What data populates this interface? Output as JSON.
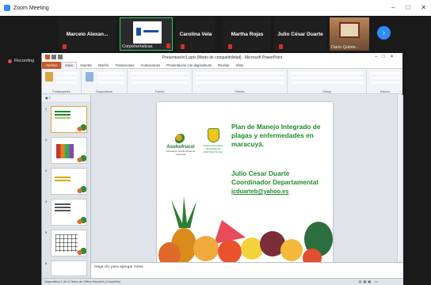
{
  "window": {
    "title": "Zoom Meeting",
    "controls": [
      "–",
      "□",
      "✕"
    ]
  },
  "participants": [
    {
      "name": "Marcelo Alexan..."
    },
    {
      "name": "",
      "caption": "Corpohortalizas",
      "active": true
    },
    {
      "name": "Carolina Vela"
    },
    {
      "name": "Martha Rojas"
    },
    {
      "name": "Julio César Duarte"
    },
    {
      "name": "",
      "caption": "Dario Quinte..."
    }
  ],
  "next_label": "›",
  "recording": {
    "label": "Recording"
  },
  "powerpoint": {
    "title": "Presentación1.pptx [Modo de compatibilidad] - Microsoft PowerPoint",
    "tabs": [
      "Archivo",
      "Inicio",
      "Insertar",
      "Diseño",
      "Transiciones",
      "Animaciones",
      "Presentación con diapositivas",
      "Revisar",
      "Vista"
    ],
    "groups": [
      "Portapapeles",
      "Diapositivas",
      "Fuente",
      "Párrafo",
      "Dibujo",
      "Edición"
    ],
    "slide_numbers": [
      "1",
      "2",
      "3",
      "4",
      "5",
      "6"
    ],
    "notes_placeholder": "Haga clic para agregar notas",
    "status": "Diapositiva 1 de 6   Tema de Office   Español (Colombia)"
  },
  "slide": {
    "logo_text": "Asohofrucol",
    "logo_sub": "Asociación Hortifrutícola de Colombia",
    "fondo_sub": "FONDO NACIONAL DE FOMENTO HORTIFRUTÍCOLA",
    "title_lines": [
      "Plan de Manejo Integrado de",
      "plagas y enfermedades en",
      "maracuyá."
    ],
    "author_lines": [
      "Julio Cesar Duarte",
      "Coordinador Departamental"
    ],
    "email": "jcduarteb@yahoo.es"
  }
}
